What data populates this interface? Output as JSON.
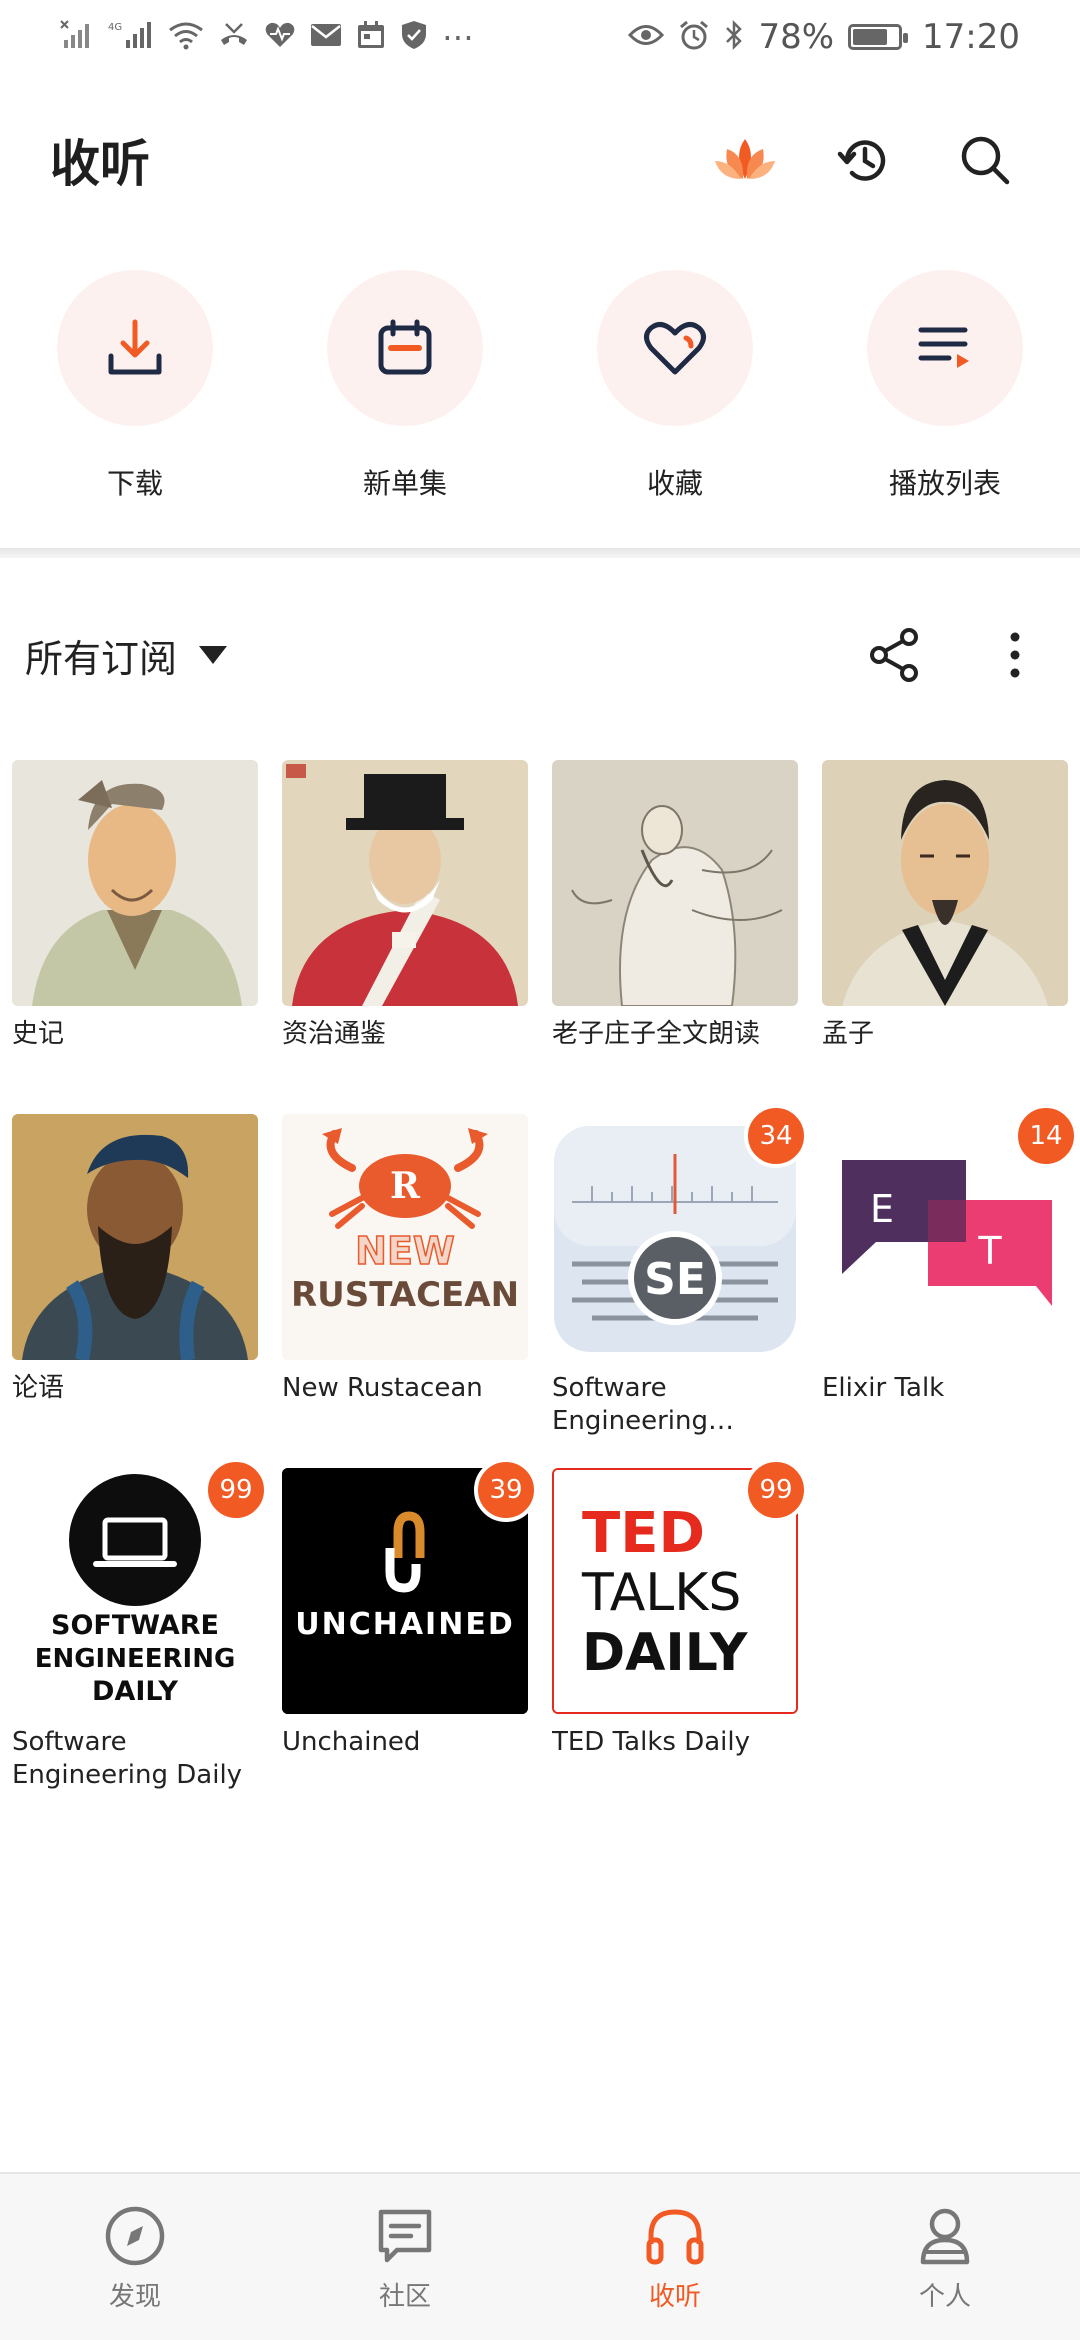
{
  "status_bar": {
    "battery_text": "78%",
    "battery_level": 0.78,
    "time": "17:20",
    "network_label": "4G"
  },
  "header": {
    "title": "收听"
  },
  "quick_actions": [
    {
      "label": "下载",
      "icon": "download-icon"
    },
    {
      "label": "新单集",
      "icon": "calendar-icon"
    },
    {
      "label": "收藏",
      "icon": "heart-icon"
    },
    {
      "label": "播放列表",
      "icon": "playlist-icon"
    }
  ],
  "subscriptions": {
    "title": "所有订阅",
    "items": [
      {
        "name": "史记",
        "badge": ""
      },
      {
        "name": "资治通鉴",
        "badge": ""
      },
      {
        "name": "老子庄子全文朗读",
        "badge": ""
      },
      {
        "name": "孟子",
        "badge": ""
      },
      {
        "name": "论语",
        "badge": ""
      },
      {
        "name": "New Rustacean",
        "badge": ""
      },
      {
        "name": "Software Engineering Radi…",
        "badge": "34"
      },
      {
        "name": "Elixir Talk",
        "badge": "14"
      },
      {
        "name": "Software Engineering Daily",
        "badge": "99"
      },
      {
        "name": "Unchained",
        "badge": "39"
      },
      {
        "name": "TED Talks Daily",
        "badge": "99"
      }
    ],
    "art_text": {
      "rustacean_line1": "NEW",
      "rustacean_line2": "RUSTACEAN",
      "rustacean_letter": "R",
      "se_radio": "SE",
      "elixir_e": "E",
      "elixir_t": "T",
      "sed_line1": "SOFTWARE",
      "sed_line2": "ENGINEERING",
      "sed_line3": "DAILY",
      "unchained": "UNCHAINED",
      "ted_line1": "TED",
      "ted_line2": "TALKS",
      "ted_line3": "DAILY"
    }
  },
  "tabs": [
    {
      "label": "发现",
      "icon": "compass-icon",
      "active": false
    },
    {
      "label": "社区",
      "icon": "chat-icon",
      "active": false
    },
    {
      "label": "收听",
      "icon": "headphones-icon",
      "active": true
    },
    {
      "label": "个人",
      "icon": "person-icon",
      "active": false
    }
  ],
  "colors": {
    "accent": "#f25a24",
    "tint": "#fdf1ef"
  }
}
